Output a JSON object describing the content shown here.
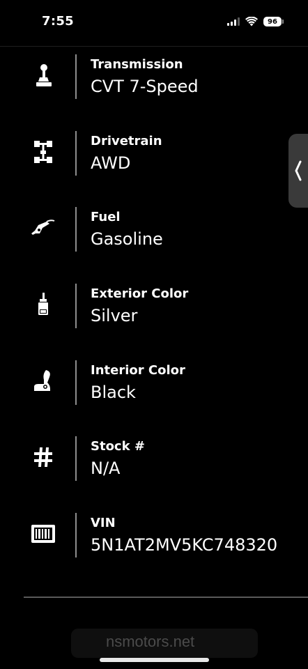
{
  "status_bar": {
    "time": "7:55",
    "battery": "96"
  },
  "specs": [
    {
      "label": "Transmission",
      "value": "CVT 7-Speed",
      "icon": "gear-shifter-icon"
    },
    {
      "label": "Drivetrain",
      "value": "AWD",
      "icon": "drivetrain-icon"
    },
    {
      "label": "Fuel",
      "value": "Gasoline",
      "icon": "fuel-nozzle-icon"
    },
    {
      "label": "Exterior Color",
      "value": "Silver",
      "icon": "paint-brush-icon"
    },
    {
      "label": "Interior Color",
      "value": "Black",
      "icon": "car-seat-icon"
    },
    {
      "label": "Stock #",
      "value": "N/A",
      "icon": "hash-icon"
    },
    {
      "label": "VIN",
      "value": "5N1AT2MV5KC748320",
      "icon": "barcode-icon"
    }
  ],
  "browser": {
    "url": "nsmotors.net"
  },
  "colors": {
    "background": "#000000",
    "text": "#ffffff",
    "separator": "#8e8e8e",
    "side_tab": "#3a3a3a"
  }
}
